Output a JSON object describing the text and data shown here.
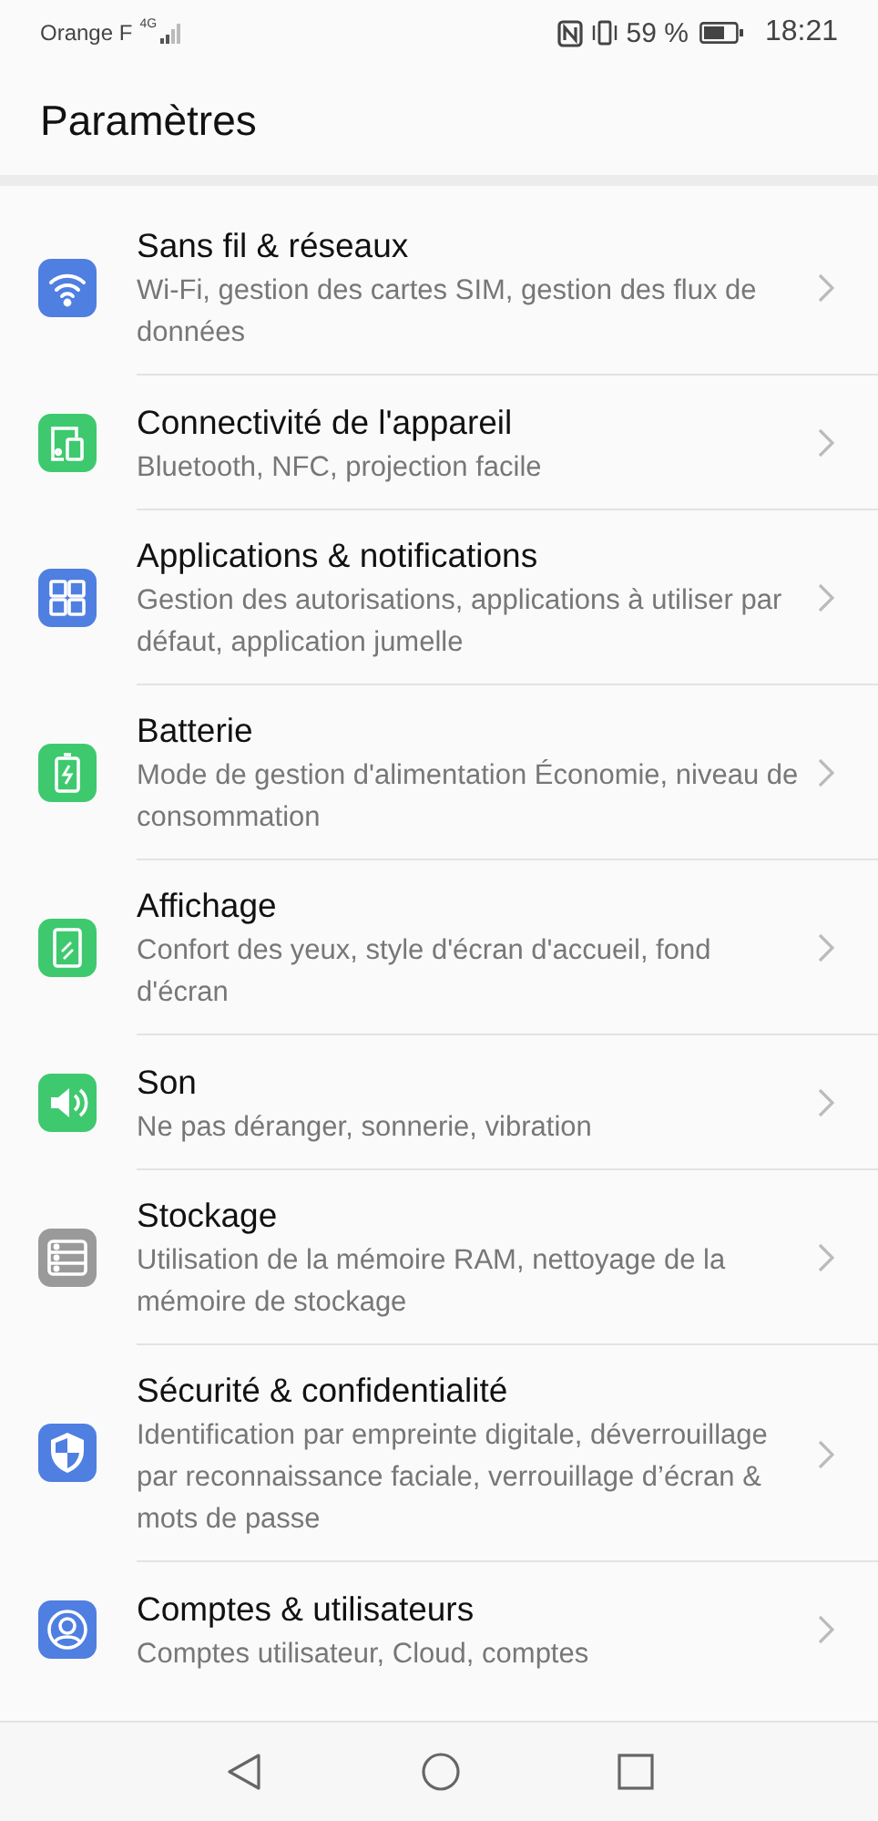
{
  "status_bar": {
    "carrier": "Orange F",
    "network": "4G",
    "battery_percent": "59 %",
    "time": "18:21"
  },
  "header": {
    "title": "Paramètres"
  },
  "items": [
    {
      "title": "Sans fil & réseaux",
      "subtitle": "Wi-Fi, gestion des cartes SIM, gestion des flux de données",
      "color": "#4f7fe0"
    },
    {
      "title": "Connectivité de l'appareil",
      "subtitle": "Bluetooth, NFC, projection facile",
      "color": "#3ec96f"
    },
    {
      "title": "Applications & notifications",
      "subtitle": "Gestion des autorisations, applications à utiliser par défaut, application jumelle",
      "color": "#4f7fe0"
    },
    {
      "title": "Batterie",
      "subtitle": "Mode de gestion d'alimentation Économie, niveau de consommation",
      "color": "#3ec96f"
    },
    {
      "title": "Affichage",
      "subtitle": "Confort des yeux, style d'écran d'accueil, fond d'écran",
      "color": "#3ec96f"
    },
    {
      "title": "Son",
      "subtitle": "Ne pas déranger, sonnerie, vibration",
      "color": "#3ec96f"
    },
    {
      "title": "Stockage",
      "subtitle": "Utilisation de la mémoire RAM, nettoyage de la mémoire de stockage",
      "color": "#9a9a9a"
    },
    {
      "title": "Sécurité & confidentialité",
      "subtitle": "Identification par empreinte digitale, déverrouillage par reconnaissance faciale, verrouillage d’écran & mots de passe",
      "color": "#4f7fe0"
    },
    {
      "title": "Comptes & utilisateurs",
      "subtitle": "Comptes utilisateur, Cloud, comptes",
      "color": "#4f7fe0"
    }
  ]
}
